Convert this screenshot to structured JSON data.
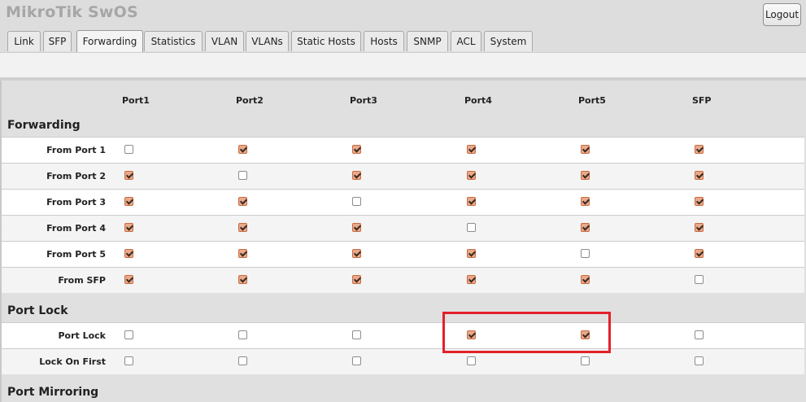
{
  "app": {
    "title": "MikroTik SwOS",
    "logout_label": "Logout"
  },
  "tabs": [
    {
      "label": "Link"
    },
    {
      "label": "SFP"
    },
    {
      "label": "Forwarding",
      "active": true
    },
    {
      "label": "Statistics"
    },
    {
      "label": "VLAN"
    },
    {
      "label": "VLANs"
    },
    {
      "label": "Static Hosts"
    },
    {
      "label": "Hosts"
    },
    {
      "label": "SNMP"
    },
    {
      "label": "ACL"
    },
    {
      "label": "System"
    }
  ],
  "columns": [
    "Port1",
    "Port2",
    "Port3",
    "Port4",
    "Port5",
    "SFP"
  ],
  "sections": {
    "forwarding": {
      "title": "Forwarding",
      "rows": [
        {
          "label": "From Port 1",
          "values": [
            false,
            true,
            true,
            true,
            true,
            true
          ]
        },
        {
          "label": "From Port 2",
          "values": [
            true,
            false,
            true,
            true,
            true,
            true
          ]
        },
        {
          "label": "From Port 3",
          "values": [
            true,
            true,
            false,
            true,
            true,
            true
          ]
        },
        {
          "label": "From Port 4",
          "values": [
            true,
            true,
            true,
            false,
            true,
            true
          ]
        },
        {
          "label": "From Port 5",
          "values": [
            true,
            true,
            true,
            true,
            false,
            true
          ]
        },
        {
          "label": "From SFP",
          "values": [
            true,
            true,
            true,
            true,
            true,
            false
          ]
        }
      ]
    },
    "port_lock": {
      "title": "Port Lock",
      "rows": [
        {
          "label": "Port Lock",
          "values": [
            false,
            false,
            false,
            true,
            true,
            false
          ]
        },
        {
          "label": "Lock On First",
          "values": [
            false,
            false,
            false,
            false,
            false,
            false
          ]
        }
      ]
    },
    "port_mirroring": {
      "title": "Port Mirroring"
    }
  },
  "colors": {
    "checked_fill": "#e9a98b",
    "highlight": "#e3202a"
  }
}
